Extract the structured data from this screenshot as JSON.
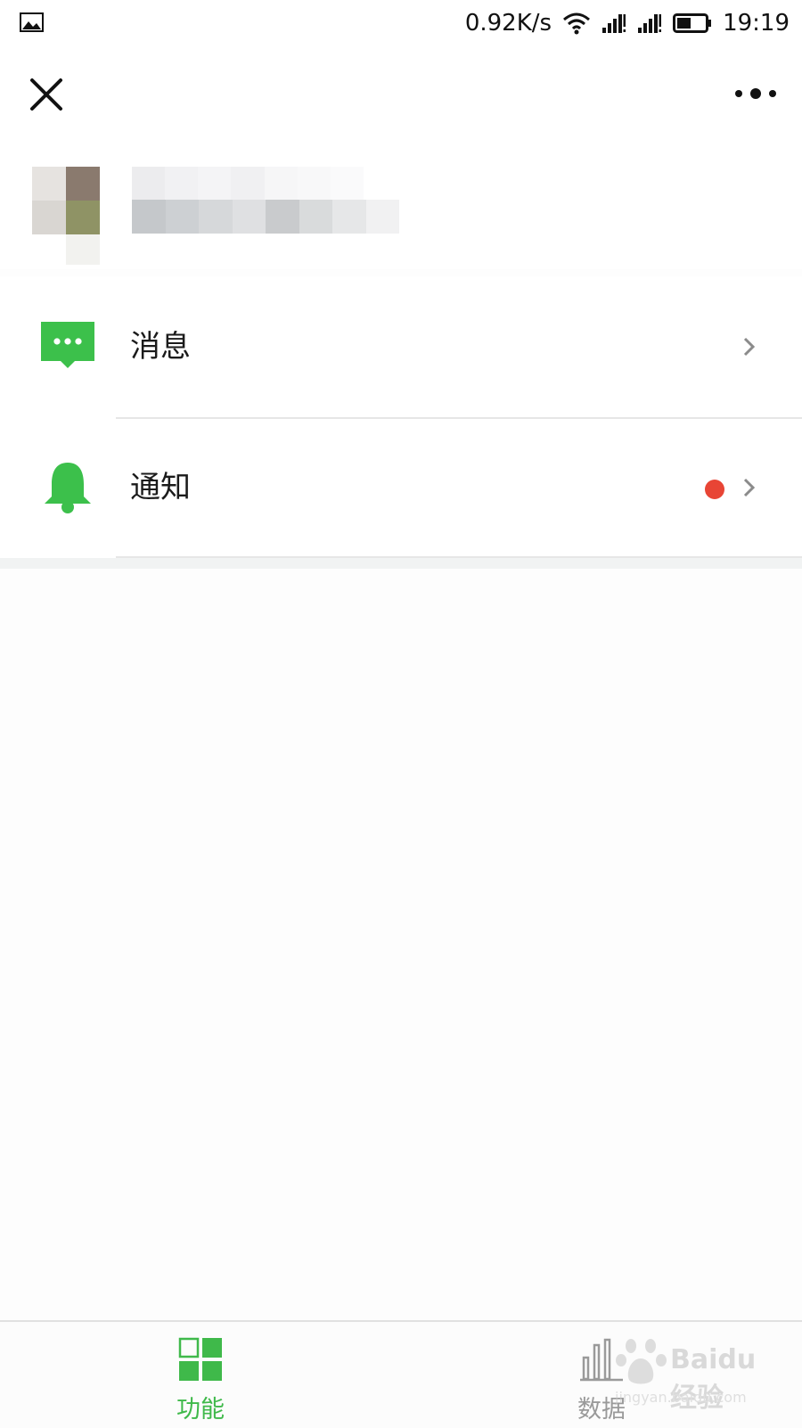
{
  "status_bar": {
    "left_icon": "gallery-icon",
    "speed": "0.92K/s",
    "time": "19:19",
    "icons": [
      "wifi-icon",
      "signal-icon",
      "signal-icon",
      "battery-icon"
    ]
  },
  "topbar": {
    "close_icon": "close-icon",
    "more_icon": "more-icon"
  },
  "profile": {
    "avatar": "avatar-pixelated",
    "name_obscured": true
  },
  "menu": {
    "items": [
      {
        "label": "消息",
        "icon": "message-bubble-icon",
        "icon_color": "#3cc04b",
        "badge": false
      },
      {
        "label": "通知",
        "icon": "bell-icon",
        "icon_color": "#3cc04b",
        "badge": true,
        "badge_color": "#e84535"
      }
    ]
  },
  "tabbar": {
    "tabs": [
      {
        "label": "功能",
        "icon": "grid-icon",
        "active": true,
        "color": "#3fb94a"
      },
      {
        "label": "数据",
        "icon": "bar-chart-icon",
        "active": false,
        "color": "#9a9a9a"
      }
    ]
  },
  "watermark": {
    "text": "Baidu 经验",
    "url": "jingyan.baidu.com"
  },
  "colors": {
    "accent": "#3cc04b",
    "badge": "#e84535",
    "background": "#fdfdfd"
  }
}
